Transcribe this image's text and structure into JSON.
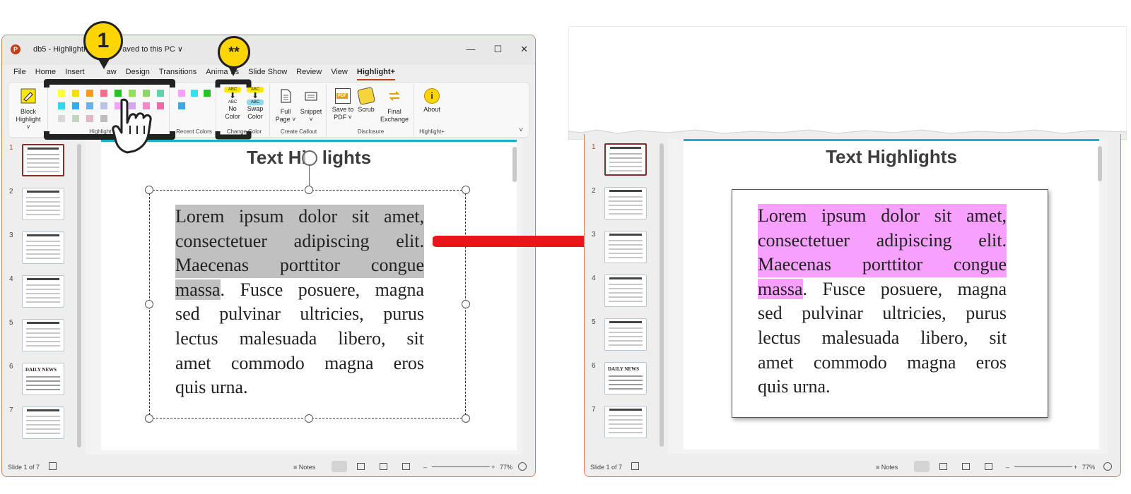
{
  "window": {
    "title": "db5 - HighlightP… • Saved to this PC ∨",
    "title_left": "db5 - HighlightP",
    "title_right": "aved to this PC ∨",
    "minimize": "—",
    "maximize": "☐",
    "close": "✕"
  },
  "menu": [
    "File",
    "Home",
    "Insert",
    "Draw",
    "Design",
    "Transitions",
    "Animations",
    "Slide Show",
    "Review",
    "View",
    "Highlight+"
  ],
  "menu_visible": [
    "File",
    "Home",
    "Insert",
    "aw",
    "Design",
    "Transitions",
    "Anima",
    "ns",
    "Slide Show",
    "Review",
    "View",
    "Highlight+"
  ],
  "ribbon": {
    "block_highlight": "Block\nHighlight ˅",
    "block_highlight_l1": "Block",
    "block_highlight_l2": "Highlight ˅",
    "highlight_colors_label": "Highlight Colors",
    "recent_colors_label": "Recent Colors",
    "change_color_label": "Change Color",
    "no_color_l1": "No",
    "no_color_l2": "Color",
    "swap_color_l1": "Swap",
    "swap_color_l2": "Color",
    "abc": "ABC",
    "create_callout_label": "Create Callout",
    "full_page_l1": "Full",
    "full_page_l2": "Page ˅",
    "snippet": "Snippet",
    "snippet_caret": "˅",
    "disclosure_label": "Disclosure",
    "save_pdf_l1": "Save to",
    "save_pdf_l2": "PDF ˅",
    "pdf": "PDF",
    "scrub": "Scrub",
    "final_exchange_l1": "Final",
    "final_exchange_l2": "Exchange",
    "highlight_plus_label": "Highlight+",
    "about": "About",
    "collapse": "˅",
    "highlight_colors": [
      [
        "#ffff33",
        "#f5e000",
        "#f59a20",
        "#f86b8c",
        "#22c322",
        "#8fe05a",
        "#8cd760",
        "#5fd1ae"
      ],
      [
        "#33d6f0",
        "#3da8e6",
        "#62b4f0",
        "#b9c4e8",
        "#f8a0ff",
        "#d8a6f0",
        "#f488c8",
        "#f06aa8"
      ],
      [
        "#d8d8d8",
        "#c0d6c0",
        "#e0b8c8",
        "#bcbcbc"
      ]
    ],
    "recent_colors": [
      [
        "#f8a0ff",
        "#33e0f0",
        "#22c322"
      ],
      [
        "#3da8e6"
      ]
    ]
  },
  "thumbnails": [
    {
      "num": "1",
      "title": "Text Highlights"
    },
    {
      "num": "2",
      "title": "Highlight Shapes"
    },
    {
      "num": "3",
      "title": "Callouts"
    },
    {
      "num": "4",
      "title": "Highlighting Text"
    },
    {
      "num": "5",
      "title": "Highlighting Text"
    },
    {
      "num": "6",
      "title": "DAILY NEWS"
    },
    {
      "num": "7",
      "title": "Anatomy"
    }
  ],
  "slide": {
    "title_left": "Text Hi",
    "title_right": "lights",
    "title_full": "Text Highlights",
    "paragraph_lines": [
      {
        "hl": "Lorem ipsum dolor sit amet,",
        "rest": ""
      },
      {
        "hl": "consectetuer adipiscing elit.",
        "rest": ""
      },
      {
        "hl": "Maecenas porttitor congue",
        "rest": ""
      },
      {
        "hl": "massa",
        "rest": ". Fusce posuere, magna"
      },
      {
        "hl": "",
        "rest": "sed pulvinar ultricies, purus"
      },
      {
        "hl": "",
        "rest": "lectus malesuada libero, sit"
      },
      {
        "hl": "",
        "rest": "amet commodo magna eros"
      },
      {
        "hl": "",
        "rest": "quis urna."
      }
    ]
  },
  "status": {
    "slide_count": "Slide 1 of 7",
    "notes": "Notes",
    "zoom": "77%",
    "zoom_minus": "–",
    "zoom_plus": "+"
  },
  "callouts": {
    "one": "1",
    "two": "**"
  },
  "colors": {
    "accent": "#c43e1c",
    "slide_bar": "#1bb0c7",
    "highlight_grey": "#c0c0c0",
    "highlight_pink": "#f8a0ff",
    "arrow": "#e8161b",
    "callout": "#ffd500"
  }
}
